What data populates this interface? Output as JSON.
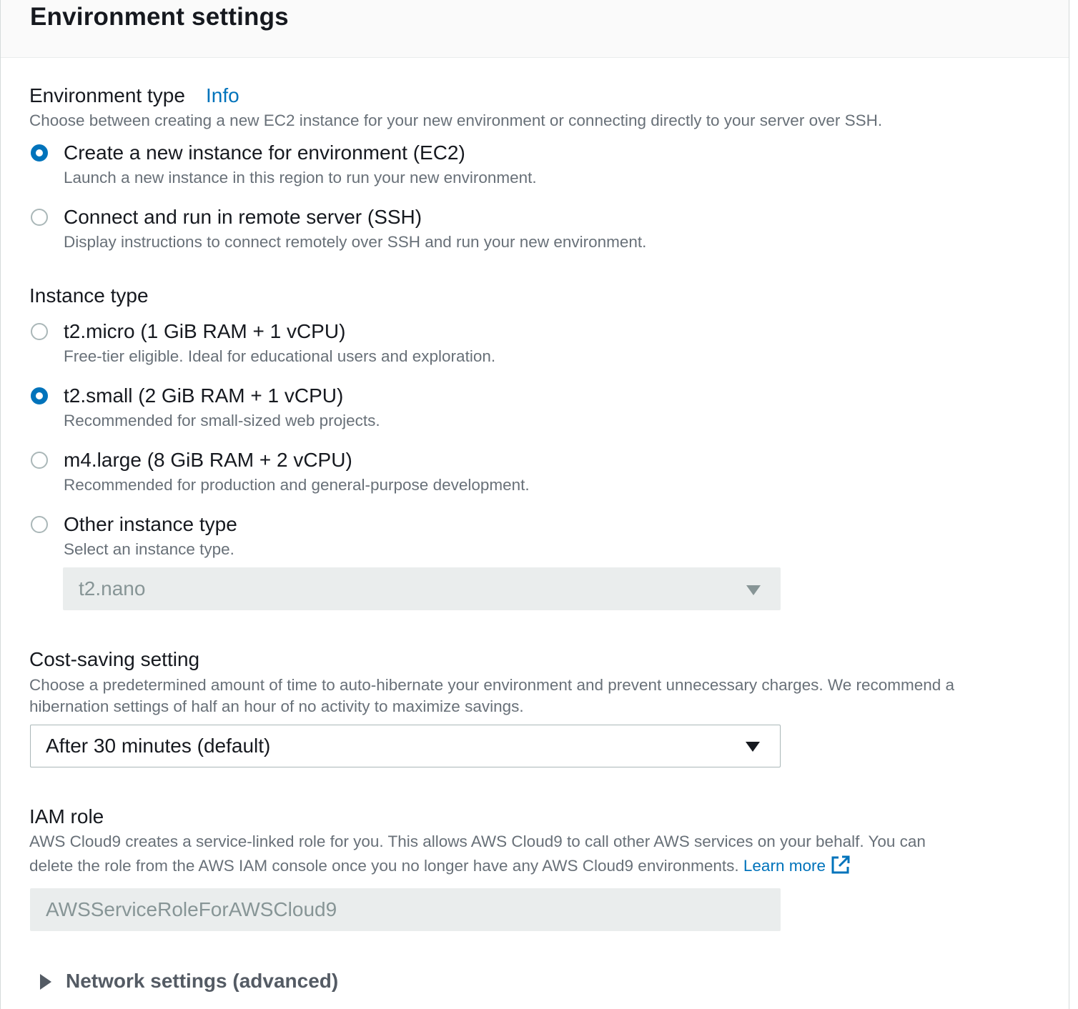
{
  "panel": {
    "title": "Environment settings"
  },
  "environment_type": {
    "label": "Environment type",
    "info_link": "Info",
    "description": "Choose between creating a new EC2 instance for your new environment or connecting directly to your server over SSH.",
    "options": [
      {
        "label": "Create a new instance for environment (EC2)",
        "description": "Launch a new instance in this region to run your new environment.",
        "selected": true
      },
      {
        "label": "Connect and run in remote server (SSH)",
        "description": "Display instructions to connect remotely over SSH and run your new environment.",
        "selected": false
      }
    ]
  },
  "instance_type": {
    "label": "Instance type",
    "options": [
      {
        "label": "t2.micro (1 GiB RAM + 1 vCPU)",
        "description": "Free-tier eligible. Ideal for educational users and exploration.",
        "selected": false
      },
      {
        "label": "t2.small (2 GiB RAM + 1 vCPU)",
        "description": "Recommended for small-sized web projects.",
        "selected": true
      },
      {
        "label": "m4.large (8 GiB RAM + 2 vCPU)",
        "description": "Recommended for production and general-purpose development.",
        "selected": false
      },
      {
        "label": "Other instance type",
        "description": "Select an instance type.",
        "selected": false
      }
    ],
    "other_select": {
      "value": "t2.nano",
      "disabled": true
    }
  },
  "cost_saving": {
    "label": "Cost-saving setting",
    "description_line1": "Choose a predetermined amount of time to auto-hibernate your environment and prevent unnecessary charges. We recommend a",
    "description_line2": "hibernation settings of half an hour of no activity to maximize savings.",
    "select_value": "After 30 minutes (default)"
  },
  "iam_role": {
    "label": "IAM role",
    "description_line1": "AWS Cloud9 creates a service-linked role for you. This allows AWS Cloud9 to call other AWS services on your behalf. You can",
    "description_line2": "delete the role from the AWS IAM console once you no longer have any AWS Cloud9 environments.",
    "learn_more": "Learn more",
    "value": "AWSServiceRoleForAWSCloud9"
  },
  "network": {
    "label": "Network settings (advanced)",
    "expanded": false
  },
  "colors": {
    "accent": "#0073bb",
    "text": "#16191f",
    "muted": "#687078",
    "disabled_bg": "#eaeded"
  }
}
